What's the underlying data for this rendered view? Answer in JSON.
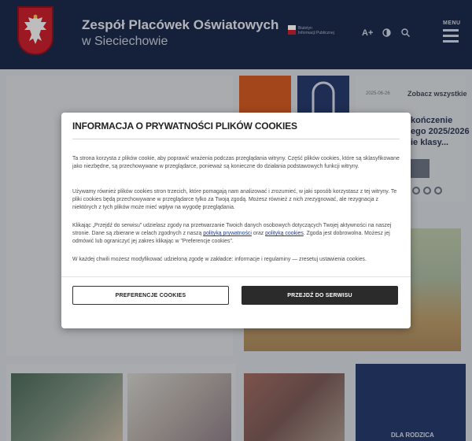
{
  "header": {
    "title_line1": "Zespół Placówek Oświatowych",
    "title_line2": "w Sieciechowie",
    "bip_line1": "Biuletyn",
    "bip_line2": "Informacji Publicznej",
    "font_increase_label": "A+",
    "contrast_icon": "contrast-icon",
    "search_icon": "search-icon",
    "menu_label": "MENU"
  },
  "news": {
    "date": "2025-06-26",
    "see_all": "Zobacz wszystkie",
    "headline_fragment_1": "kończenie",
    "headline_fragment_2": "ego 2025/2026",
    "headline_fragment_3": "ie klasy..."
  },
  "tiles": {
    "parents_label": "DLA RODZICA"
  },
  "cookie_modal": {
    "title": "INFORMACJA O PRYWATNOŚCI PLIKÓW COOKIES",
    "p1": "Ta strona korzysta z plików cookie, aby poprawić wrażenia podczas przeglądania witryny. Część plików cookies, które są sklasyfikowane jako niezbędne, są przechowywane w przeglądarce, ponieważ są konieczne do działania podstawowych funkcji witryny.",
    "p2": "Używamy również plików cookies stron trzecich, które pomagają nam analizować i zrozumieć, w jaki sposób korzystasz z tej witryny. Te pliki cookies będą przechowywane w przeglądarce tylko za Twoją zgodą. Możesz również z nich zrezygnować, ale rezygnacja z niektórych z tych plików może mieć wpływ na wygodę przeglądania.",
    "p3_part1": "Klikając „Przejdź do serwisu” udzielasz zgody na przetwarzanie Twoich danych osobowych dotyczących Twojej aktywności na naszej stronie. Dane są zbierane w celach zgodnych z naszą ",
    "p3_link1": "polityką prywatności",
    "p3_part2": " oraz ",
    "p3_link2": "polityką cookies",
    "p3_part3": ". Zgoda jest dobrowolna. Możesz jej odmówić lub ograniczyć jej zakres klikając w \"Preferencje cookies\".",
    "p4": "W każdej chwili możesz modyfikować udzieloną zgodę w zakładce: informacje i regulaminy — zresetuj ustawienia cookies.",
    "preferences_button": "PREFERENCJE COOKIES",
    "accept_button": "PRZEJDŹ DO SERWISU"
  },
  "colors": {
    "header_bg": "#1b2a4b",
    "emblem_red": "#c8202e",
    "accent_orange": "#d35a24",
    "dark_button": "#2b2b2b",
    "link_blue": "#1f3a8a"
  }
}
